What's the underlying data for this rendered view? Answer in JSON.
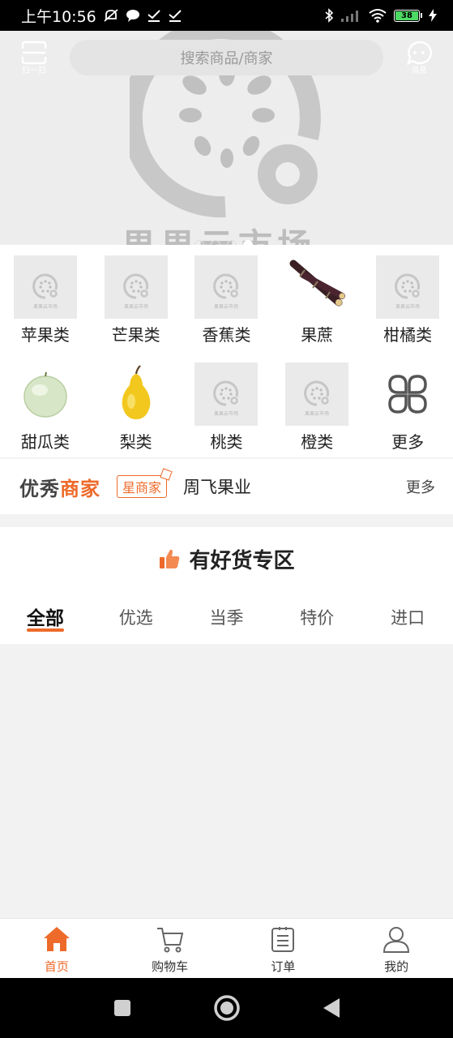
{
  "status_bar": {
    "time": "上午10:56",
    "battery": "38"
  },
  "topbar": {
    "scan_label": "扫一扫",
    "search_placeholder": "搜索商品/商家",
    "message_label": "消息"
  },
  "banner": {
    "watermark_text": "果果云市场"
  },
  "categories": [
    {
      "label": "苹果类",
      "image": "placeholder-logo"
    },
    {
      "label": "芒果类",
      "image": "placeholder-logo"
    },
    {
      "label": "香蕉类",
      "image": "placeholder-logo"
    },
    {
      "label": "果蔗",
      "image": "sugarcane"
    },
    {
      "label": "柑橘类",
      "image": "placeholder-logo"
    },
    {
      "label": "甜瓜类",
      "image": "melon"
    },
    {
      "label": "梨类",
      "image": "pear"
    },
    {
      "label": "桃类",
      "image": "placeholder-logo"
    },
    {
      "label": "橙类",
      "image": "placeholder-logo"
    },
    {
      "label": "更多",
      "image": "grid-icon"
    }
  ],
  "placeholder_caption": "果果云市场",
  "merchants": {
    "title_part1": "优秀",
    "title_part2": "商家",
    "badge": "星商家",
    "name": "周飞果业",
    "more": "更多"
  },
  "goods": {
    "title": "有好货专区",
    "tabs": [
      "全部",
      "优选",
      "当季",
      "特价",
      "进口"
    ],
    "active_tab": "全部"
  },
  "bottom_nav": [
    {
      "label": "首页",
      "icon": "home-icon",
      "active": true
    },
    {
      "label": "购物车",
      "icon": "cart-icon",
      "active": false
    },
    {
      "label": "订单",
      "icon": "order-icon",
      "active": false
    },
    {
      "label": "我的",
      "icon": "profile-icon",
      "active": false
    }
  ],
  "colors": {
    "accent": "#ee6a2a",
    "background": "#f2f2f2"
  }
}
